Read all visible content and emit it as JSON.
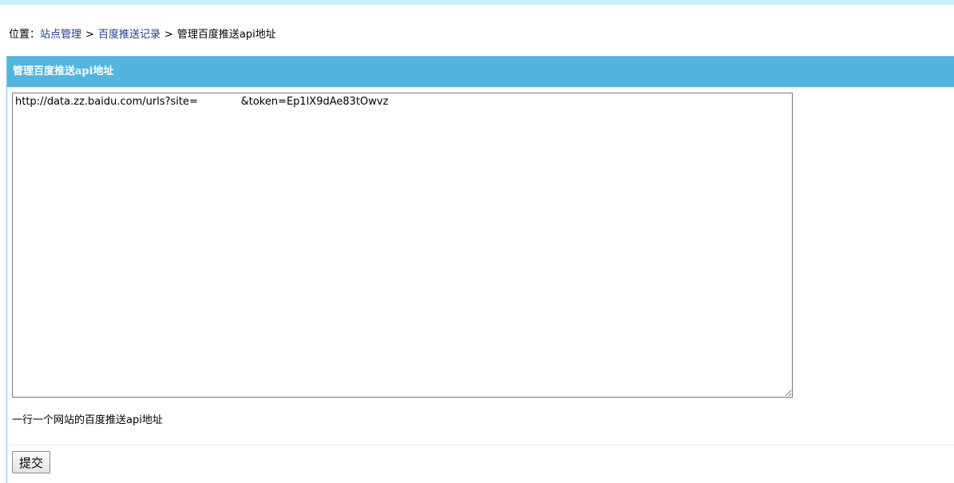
{
  "breadcrumb": {
    "prefix": "位置：",
    "items": [
      {
        "label": "站点管理"
      },
      {
        "label": "百度推送记录"
      }
    ],
    "separator": ">",
    "current": "管理百度推送api地址"
  },
  "panel": {
    "title": "管理百度推送api地址",
    "textarea_value": "http://data.zz.baidu.com/urls?site=             &token=Ep1lX9dAe83tOwvz",
    "hint": "一行一个网站的百度推送api地址",
    "submit_label": "提交"
  },
  "colors": {
    "top_bar": "#c8eef8",
    "header_bg": "#53b4dd",
    "link": "#1f3a8a"
  }
}
